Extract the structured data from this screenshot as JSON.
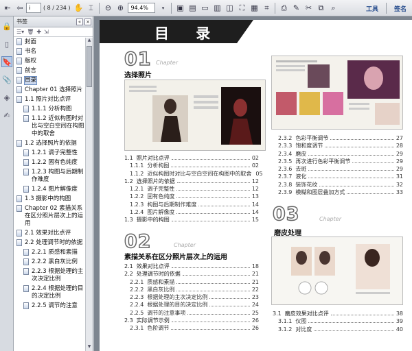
{
  "toolbar": {
    "page_current": "i",
    "page_of": "( 8 / 234 )",
    "zoom": "94.4%",
    "tools_label": "工具",
    "sign_label": "签名"
  },
  "panel": {
    "title": "书签"
  },
  "bookmarks": [
    {
      "label": "封面",
      "level": 0
    },
    {
      "label": "书名",
      "level": 0
    },
    {
      "label": "版权",
      "level": 0
    },
    {
      "label": "前言",
      "level": 0
    },
    {
      "label": "目录",
      "level": 0,
      "selected": true
    },
    {
      "label": "Chapter 01  选择照片",
      "level": 0
    },
    {
      "label": "1.1  照片对比点评",
      "level": 0
    },
    {
      "label": "1.1.1  分析构图",
      "level": 1
    },
    {
      "label": "1.1.2  近似构图时对比与空白空间在构图中的取舍",
      "level": 1
    },
    {
      "label": "1.2  选择照片的依据",
      "level": 0
    },
    {
      "label": "1.2.1  调子完整性",
      "level": 1
    },
    {
      "label": "1.2.2  固有色纯度",
      "level": 1
    },
    {
      "label": "1.2.3  构图与后期制作难度",
      "level": 1
    },
    {
      "label": "1.2.4  图片解像度",
      "level": 1
    },
    {
      "label": "1.3  摄影中的构图",
      "level": 0
    },
    {
      "label": "Chapter 02  素描关系在区分照片层次上的运用",
      "level": 0
    },
    {
      "label": "2.1  效果对比点评",
      "level": 0
    },
    {
      "label": "2.2  处理调节时的依据",
      "level": 0
    },
    {
      "label": "2.2.1  质感和素描",
      "level": 1
    },
    {
      "label": "2.2.2  黑白灰比例",
      "level": 1
    },
    {
      "label": "2.2.3  根据处理的主次决定比例",
      "level": 1
    },
    {
      "label": "2.2.4  根据处理的目的决定比例",
      "level": 1
    },
    {
      "label": "2.2.5  调节的注意",
      "level": 1
    }
  ],
  "page": {
    "heading": "目  录",
    "chapters": [
      {
        "num": "01",
        "word": "Chapter",
        "title": "选择照片"
      },
      {
        "num": "02",
        "word": "Chapter",
        "title": "素描关系在区分照片层次上的运用"
      },
      {
        "num": "03",
        "word": "Chapter",
        "title": "磨皮处理"
      }
    ],
    "toc_ch1": [
      {
        "num": "1.1",
        "label": "照片对比点评",
        "page": "02",
        "lvl": 1
      },
      {
        "num": "1.1.1",
        "label": "分析构图",
        "page": "02",
        "lvl": 2
      },
      {
        "num": "1.1.2",
        "label": "近似构图时对比与空白空间在构图中的取舍",
        "page": "05",
        "lvl": 2
      },
      {
        "num": "1.2",
        "label": "选择照片的依据",
        "page": "12",
        "lvl": 1
      },
      {
        "num": "1.2.1",
        "label": "调子完整性",
        "page": "12",
        "lvl": 2
      },
      {
        "num": "1.2.2",
        "label": "固有色纯度",
        "page": "13",
        "lvl": 2
      },
      {
        "num": "1.2.3",
        "label": "构图与后期制作难度",
        "page": "14",
        "lvl": 2
      },
      {
        "num": "1.2.4",
        "label": "图片解像度",
        "page": "14",
        "lvl": 2
      },
      {
        "num": "1.3",
        "label": "摄影中的构图",
        "page": "15",
        "lvl": 1
      }
    ],
    "toc_ch2": [
      {
        "num": "2.1",
        "label": "效果对比点评",
        "page": "18",
        "lvl": 1
      },
      {
        "num": "2.2",
        "label": "处理调节时的依据",
        "page": "21",
        "lvl": 1
      },
      {
        "num": "2.2.1",
        "label": "质感和素描",
        "page": "21",
        "lvl": 2
      },
      {
        "num": "2.2.2",
        "label": "黑白灰比例",
        "page": "22",
        "lvl": 2
      },
      {
        "num": "2.2.3",
        "label": "根据处理的主次决定比例",
        "page": "23",
        "lvl": 2
      },
      {
        "num": "2.2.4",
        "label": "根据处理的目的决定比例",
        "page": "24",
        "lvl": 2
      },
      {
        "num": "2.2.5",
        "label": "调节的注意事项",
        "page": "25",
        "lvl": 2
      },
      {
        "num": "2.3",
        "label": "实际调节示例",
        "page": "26",
        "lvl": 1
      },
      {
        "num": "2.3.1",
        "label": "色阶调节",
        "page": "26",
        "lvl": 2
      }
    ],
    "toc_right": [
      {
        "num": "2.3.2",
        "label": "色彩平衡调节",
        "page": "27",
        "lvl": 2
      },
      {
        "num": "2.3.3",
        "label": "饱和度调节",
        "page": "28",
        "lvl": 2
      },
      {
        "num": "2.3.4",
        "label": "磨皮",
        "page": "29",
        "lvl": 2
      },
      {
        "num": "2.3.5",
        "label": "再次进行色彩平衡调节",
        "page": "29",
        "lvl": 2
      },
      {
        "num": "2.3.6",
        "label": "去斑",
        "page": "29",
        "lvl": 2
      },
      {
        "num": "2.3.7",
        "label": "液化",
        "page": "31",
        "lvl": 2
      },
      {
        "num": "2.3.8",
        "label": "装饰花纹",
        "page": "32",
        "lvl": 2
      },
      {
        "num": "2.3.9",
        "label": "模糊和图层叠加方式",
        "page": "33",
        "lvl": 2
      }
    ],
    "toc_ch3": [
      {
        "num": "3.1",
        "label": "磨皮效果对比点评",
        "page": "38",
        "lvl": 1
      },
      {
        "num": "3.1.1",
        "label": "仪图",
        "page": "39",
        "lvl": 2
      },
      {
        "num": "3.1.2",
        "label": "对比度",
        "page": "40",
        "lvl": 2
      }
    ]
  }
}
